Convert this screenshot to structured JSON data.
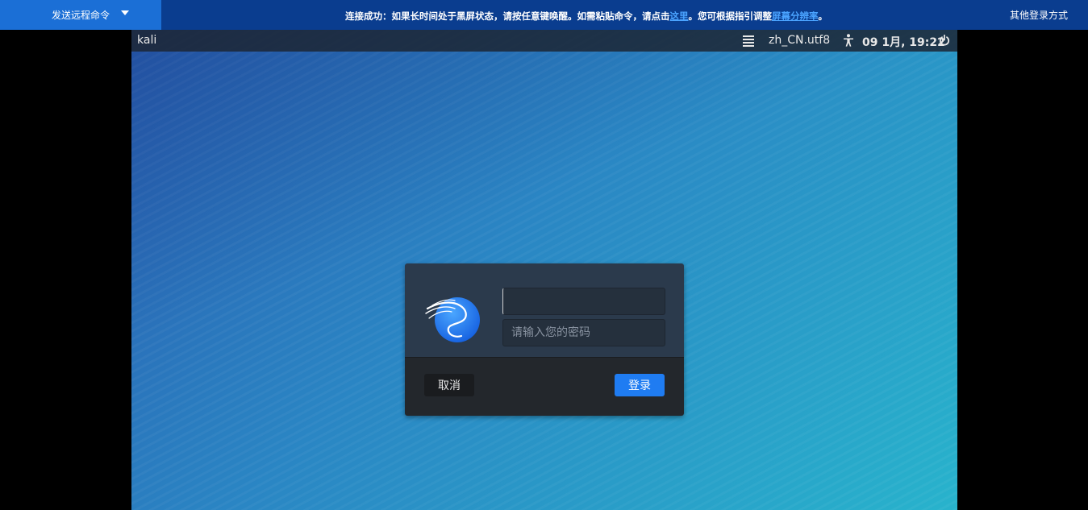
{
  "topbar": {
    "send_command_label": "发送远程命令",
    "notice_part1": "连接成功：如果长时间处于黑屏状态，请按任意键唤醒。如需粘贴命令，请点击",
    "notice_link1": "这里",
    "notice_part2": "。您可根据指引调整",
    "notice_link2": "屏幕分辨率",
    "notice_part3": "。",
    "other_login_label": "其他登录方式"
  },
  "gnome_bar": {
    "hostname": "kali",
    "locale": "zh_CN.utf8",
    "clock": "09 1月, 19:22"
  },
  "login_dialog": {
    "username_value": "",
    "password_placeholder": "请输入您的密码",
    "cancel_label": "取消",
    "login_label": "登录"
  },
  "colors": {
    "accent_blue": "#1f7cf2",
    "topbar_bg": "#0a3d8f",
    "send_command_bg": "#1b6fd6"
  }
}
